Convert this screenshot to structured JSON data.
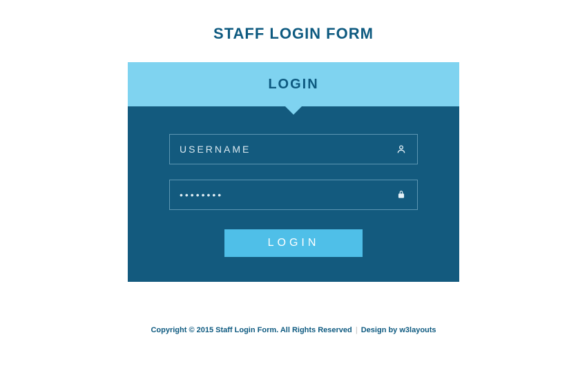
{
  "page": {
    "title": "STAFF LOGIN FORM"
  },
  "card": {
    "header": "LOGIN",
    "username": {
      "placeholder": "USERNAME",
      "value": ""
    },
    "password": {
      "placeholder": "••••••••",
      "value": ""
    },
    "submit_label": "LOGIN"
  },
  "footer": {
    "copyright": "Copyright © 2015 Staff Login Form. All Rights Reserved",
    "separator": "|",
    "design_by_prefix": "Design by ",
    "design_by_link": "w3layouts"
  }
}
